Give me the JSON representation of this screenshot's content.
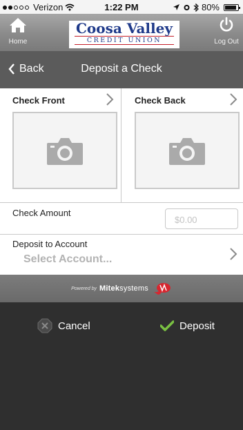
{
  "status_bar": {
    "carrier": "Verizon",
    "time": "1:22 PM",
    "battery": "80%"
  },
  "header": {
    "home_label": "Home",
    "logo_title": "Coosa Valley",
    "logo_subtitle": "CREDIT UNION",
    "logout_label": "Log Out"
  },
  "nav": {
    "back_label": "Back",
    "title": "Deposit a Check"
  },
  "check": {
    "front_label": "Check Front",
    "back_label": "Check Back"
  },
  "amount": {
    "label": "Check Amount",
    "placeholder": "$0.00"
  },
  "account": {
    "label": "Deposit to Account",
    "value": "Select Account..."
  },
  "powered_by": {
    "prefix": "Powered by",
    "brand_bold": "Mitek",
    "brand_light": "systems"
  },
  "toolbar": {
    "cancel_label": "Cancel",
    "deposit_label": "Deposit"
  },
  "colors": {
    "nav_bar": "#5b5b5b",
    "toolbar": "#2f2f2f",
    "deposit_check": "#7ac142",
    "logo_blue": "#1f3a8a",
    "logo_red": "#c41e2a"
  }
}
